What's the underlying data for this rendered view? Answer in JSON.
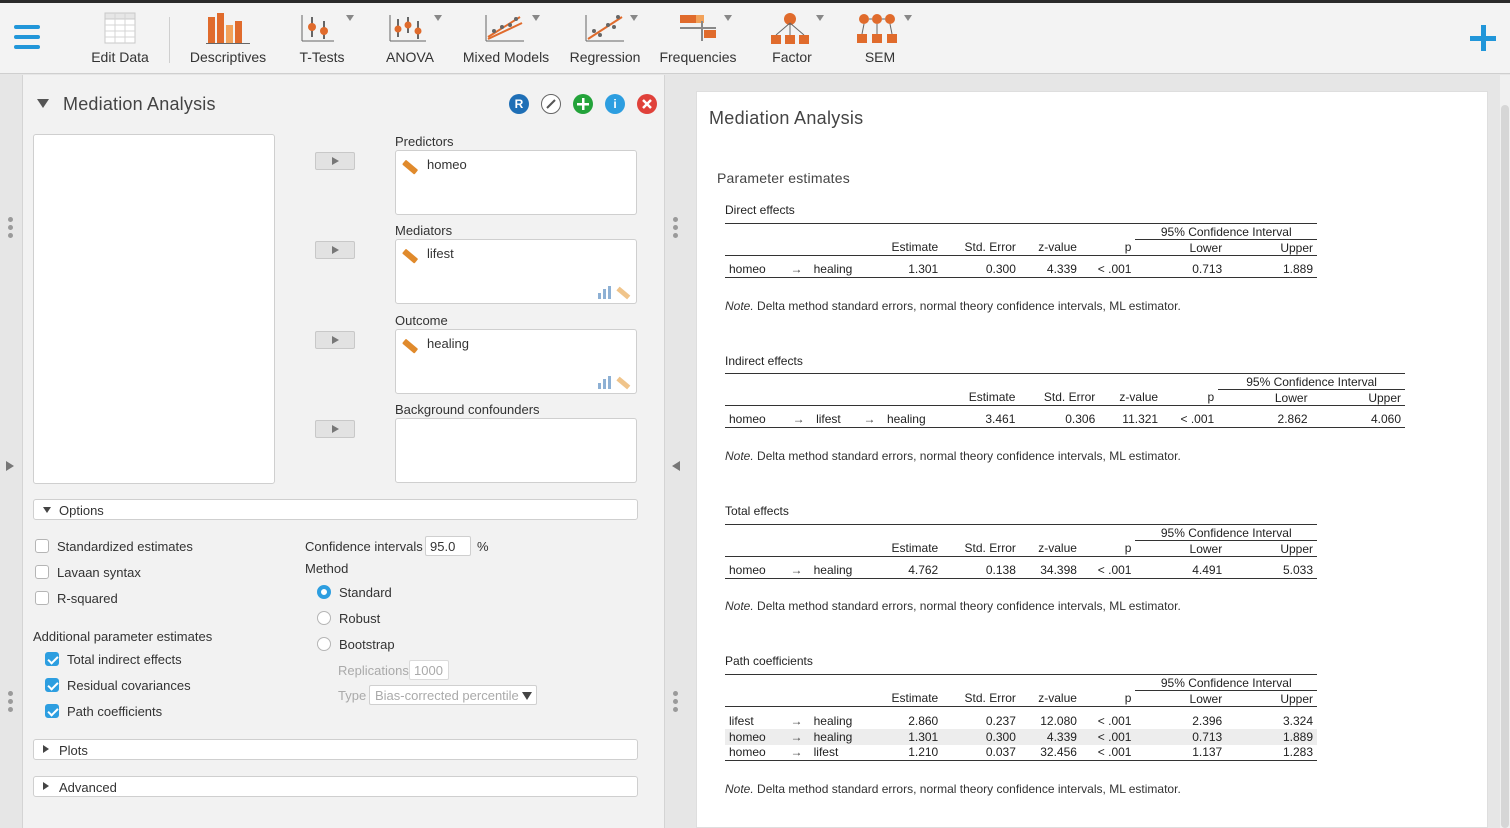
{
  "toolbar": {
    "items": [
      {
        "label": "Edit Data",
        "icon": "spreadsheet-icon"
      },
      {
        "label": "Descriptives",
        "icon": "bar-chart-icon"
      },
      {
        "label": "T-Tests",
        "icon": "t-tests-icon"
      },
      {
        "label": "ANOVA",
        "icon": "anova-icon"
      },
      {
        "label": "Mixed Models",
        "icon": "mixed-models-icon"
      },
      {
        "label": "Regression",
        "icon": "regression-icon"
      },
      {
        "label": "Frequencies",
        "icon": "frequencies-icon"
      },
      {
        "label": "Factor",
        "icon": "factor-icon"
      },
      {
        "label": "SEM",
        "icon": "sem-icon"
      }
    ]
  },
  "analysis": {
    "title": "Mediation Analysis",
    "buttons": {
      "r": "R",
      "info": "i"
    },
    "predictors": {
      "label": "Predictors",
      "items": [
        "homeo"
      ]
    },
    "mediators": {
      "label": "Mediators",
      "items": [
        "lifest"
      ]
    },
    "outcome": {
      "label": "Outcome",
      "items": [
        "healing"
      ]
    },
    "confounders": {
      "label": "Background confounders",
      "items": []
    }
  },
  "options": {
    "section_label": "Options",
    "standardized": {
      "label": "Standardized estimates",
      "checked": false
    },
    "lavaan": {
      "label": "Lavaan syntax",
      "checked": false
    },
    "rsquared": {
      "label": "R-squared",
      "checked": false
    },
    "additional_label": "Additional parameter estimates",
    "total_indirect": {
      "label": "Total indirect effects",
      "checked": true
    },
    "residual_cov": {
      "label": "Residual covariances",
      "checked": true
    },
    "path_coef": {
      "label": "Path coefficients",
      "checked": true
    },
    "ci_label": "Confidence intervals",
    "ci_value": "95.0",
    "ci_unit": "%",
    "method_label": "Method",
    "methods": [
      "Standard",
      "Robust",
      "Bootstrap"
    ],
    "method_selected": "Standard",
    "replications_label": "Replications",
    "replications_value": "1000",
    "type_label": "Type",
    "type_value": "Bias-corrected percentile"
  },
  "plots": {
    "label": "Plots"
  },
  "advanced": {
    "label": "Advanced"
  },
  "output": {
    "title": "Mediation Analysis",
    "subtitle": "Parameter estimates",
    "ci_header": "95% Confidence Interval",
    "headers": {
      "estimate": "Estimate",
      "se": "Std. Error",
      "z": "z-value",
      "p": "p",
      "lower": "Lower",
      "upper": "Upper"
    },
    "arrow": "→",
    "note_prefix": "Note.",
    "note_text": " Delta method standard errors, normal theory confidence intervals, ML estimator.",
    "direct": {
      "title": "Direct effects",
      "rows": [
        {
          "from": "homeo",
          "to": "healing",
          "estimate": "1.301",
          "se": "0.300",
          "z": "4.339",
          "p": "< .001",
          "lower": "0.713",
          "upper": "1.889"
        }
      ]
    },
    "indirect": {
      "title": "Indirect effects",
      "rows": [
        {
          "from": "homeo",
          "via": "lifest",
          "to": "healing",
          "estimate": "3.461",
          "se": "0.306",
          "z": "11.321",
          "p": "< .001",
          "lower": "2.862",
          "upper": "4.060"
        }
      ]
    },
    "total": {
      "title": "Total effects",
      "rows": [
        {
          "from": "homeo",
          "to": "healing",
          "estimate": "4.762",
          "se": "0.138",
          "z": "34.398",
          "p": "< .001",
          "lower": "4.491",
          "upper": "5.033"
        }
      ]
    },
    "paths": {
      "title": "Path coefficients",
      "rows": [
        {
          "from": "lifest",
          "to": "healing",
          "estimate": "2.860",
          "se": "0.237",
          "z": "12.080",
          "p": "< .001",
          "lower": "2.396",
          "upper": "3.324"
        },
        {
          "from": "homeo",
          "to": "healing",
          "estimate": "1.301",
          "se": "0.300",
          "z": "4.339",
          "p": "< .001",
          "lower": "0.713",
          "upper": "1.889"
        },
        {
          "from": "homeo",
          "to": "lifest",
          "estimate": "1.210",
          "se": "0.037",
          "z": "32.456",
          "p": "< .001",
          "lower": "1.137",
          "upper": "1.283"
        }
      ]
    }
  }
}
